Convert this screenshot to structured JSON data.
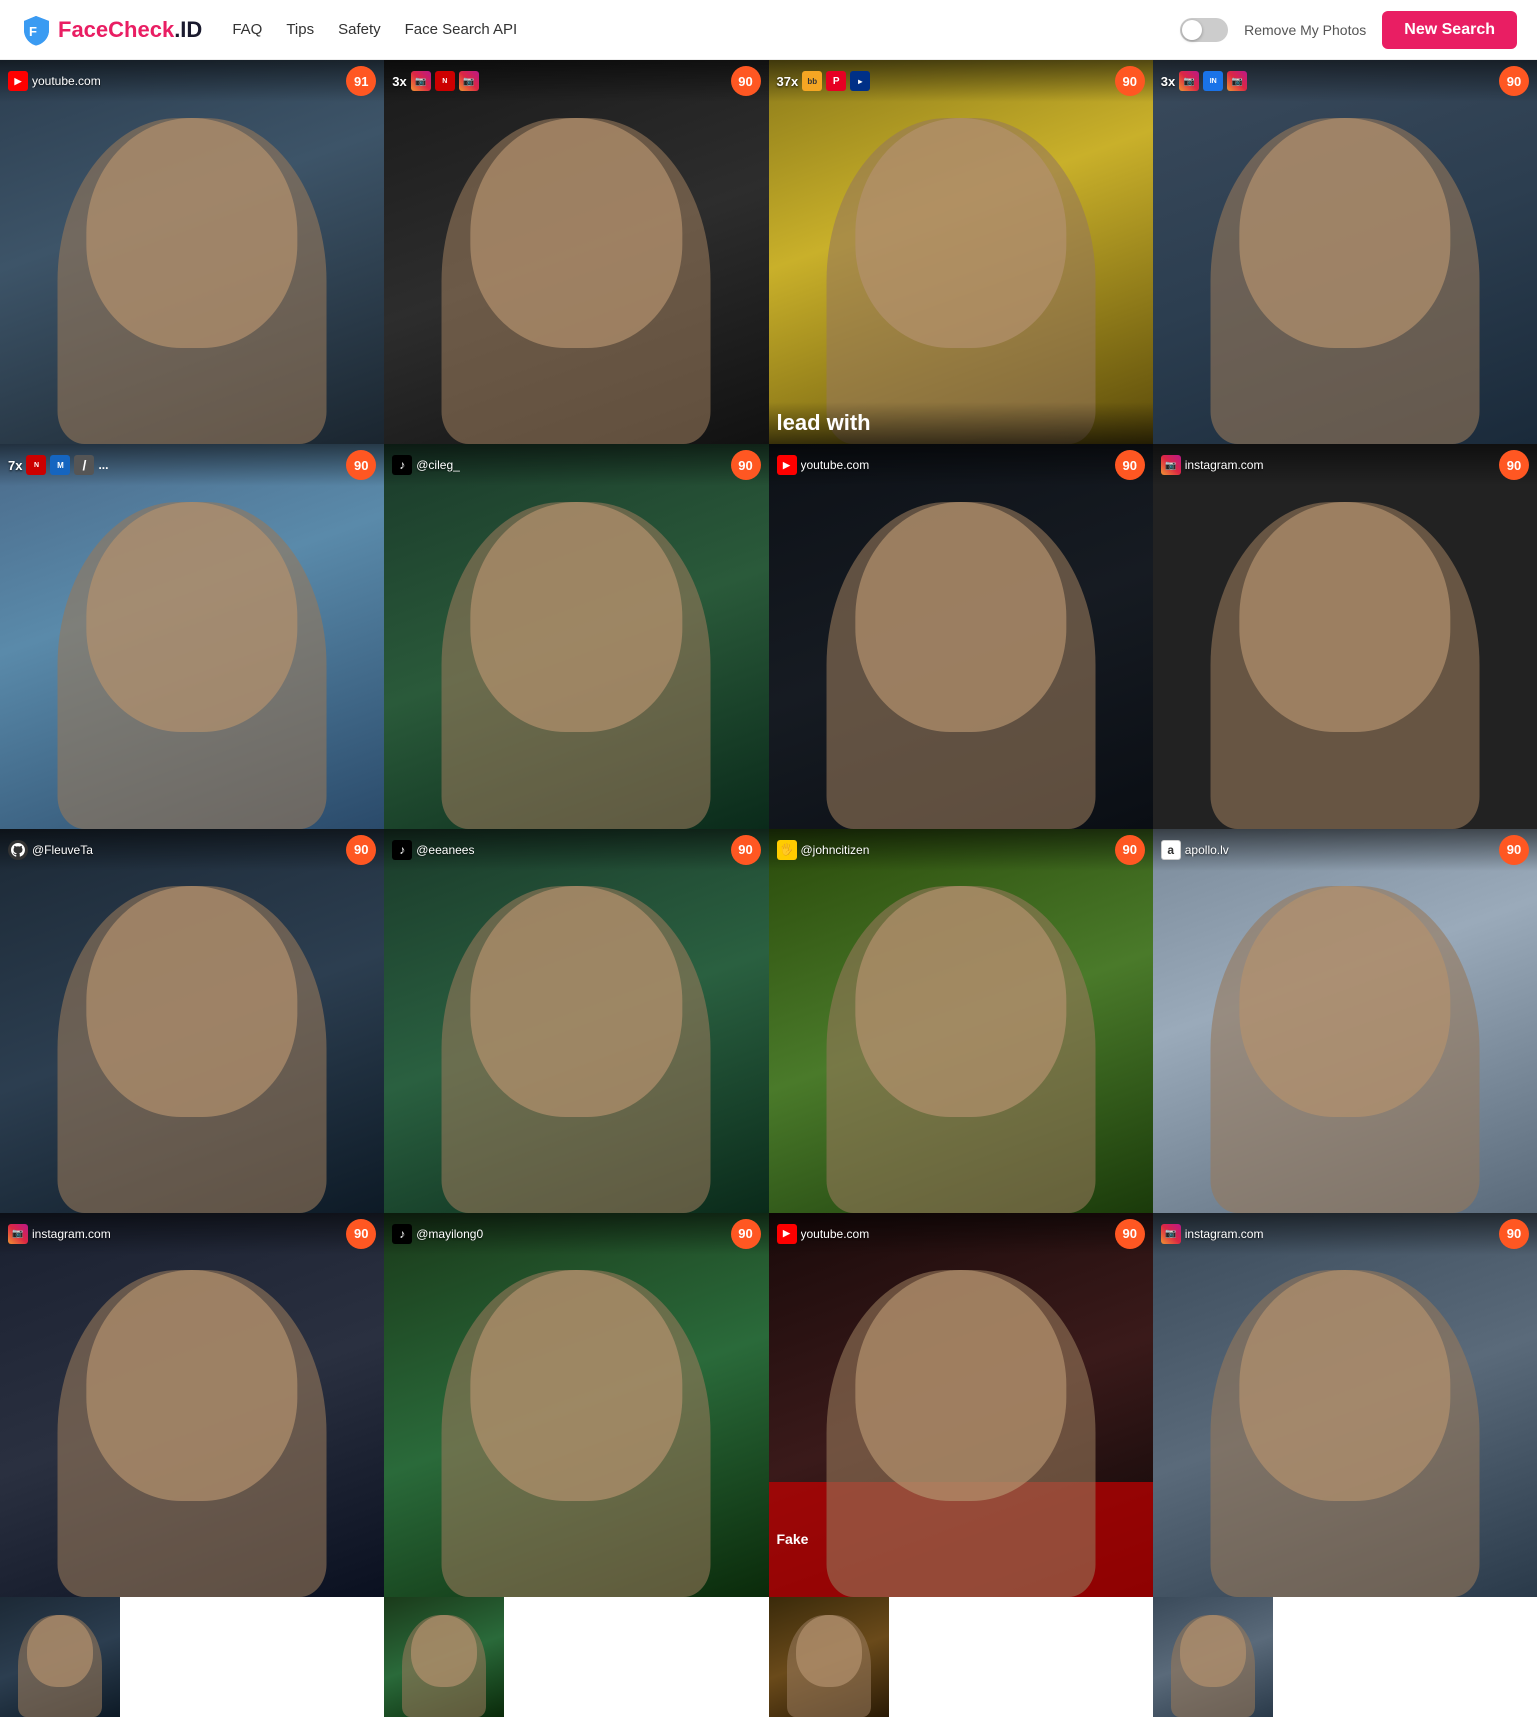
{
  "header": {
    "logo_text_brand": "FaceCheck",
    "logo_text_domain": ".ID",
    "nav": [
      {
        "label": "FAQ",
        "href": "#"
      },
      {
        "label": "Tips",
        "href": "#"
      },
      {
        "label": "Safety",
        "href": "#"
      },
      {
        "label": "Face Search API",
        "href": "#"
      }
    ],
    "remove_photos_label": "Remove My Photos",
    "new_search_label": "New Search"
  },
  "results": {
    "cells": [
      {
        "id": 1,
        "source_type": "youtube",
        "source_icon": "YT",
        "source_label": "youtube.com",
        "multiplier": null,
        "extra_icons": [],
        "score": 91,
        "bg": "face-bg-1",
        "row": 1
      },
      {
        "id": 2,
        "source_type": "instagram",
        "source_icon": "IG",
        "source_label": "",
        "multiplier": "3x",
        "extra_icons": [
          "ig",
          "nk",
          "ig"
        ],
        "score": 90,
        "bg": "face-bg-2",
        "row": 1
      },
      {
        "id": 3,
        "source_type": "instagram",
        "source_icon": "IG",
        "source_label": "",
        "multiplier": "37x",
        "extra_icons": [
          "bb",
          "pt",
          "ba"
        ],
        "score": 90,
        "bg": "face-bg-3",
        "overlay_text": "lead with",
        "row": 1
      },
      {
        "id": 4,
        "source_type": "instagram",
        "source_icon": "IG",
        "source_label": "",
        "multiplier": "3x",
        "extra_icons": [
          "ig",
          "ins",
          "ig"
        ],
        "score": 90,
        "bg": "face-bg-4",
        "row": 1
      },
      {
        "id": 5,
        "source_type": "nikkei",
        "source_icon": "NK",
        "source_label": "",
        "multiplier": "7x",
        "extra_icons": [
          "nk",
          "mc",
          "dots"
        ],
        "score": 90,
        "bg": "face-bg-5",
        "row": 2
      },
      {
        "id": 6,
        "source_type": "tiktok",
        "source_icon": "TT",
        "source_label": "@cileg_",
        "multiplier": null,
        "extra_icons": [],
        "score": 90,
        "bg": "face-bg-6",
        "row": 2
      },
      {
        "id": 7,
        "source_type": "youtube",
        "source_icon": "YT",
        "source_label": "youtube.com",
        "multiplier": null,
        "extra_icons": [],
        "score": 90,
        "bg": "face-bg-7",
        "row": 2
      },
      {
        "id": 8,
        "source_type": "instagram",
        "source_icon": "IG",
        "source_label": "instagram.com",
        "multiplier": null,
        "extra_icons": [],
        "score": 90,
        "bg": "face-bg-8",
        "row": 2
      },
      {
        "id": 9,
        "source_type": "github",
        "source_icon": "GH",
        "source_label": "@FleuveTa",
        "multiplier": null,
        "extra_icons": [],
        "score": 90,
        "bg": "face-bg-9",
        "row": 3
      },
      {
        "id": 10,
        "source_type": "tiktok",
        "source_icon": "TT",
        "source_label": "@eeanees",
        "multiplier": null,
        "extra_icons": [],
        "score": 90,
        "bg": "face-bg-10",
        "row": 3
      },
      {
        "id": 11,
        "source_type": "joinchat",
        "source_icon": "JC",
        "source_label": "@johncitizen",
        "multiplier": null,
        "extra_icons": [],
        "score": 90,
        "bg": "face-bg-11",
        "row": 3
      },
      {
        "id": 12,
        "source_type": "apollo",
        "source_icon": "a",
        "source_label": "apollo.lv",
        "multiplier": null,
        "extra_icons": [],
        "score": 90,
        "bg": "face-bg-12",
        "row": 3
      },
      {
        "id": 13,
        "source_type": "instagram",
        "source_icon": "IG",
        "source_label": "instagram.com",
        "multiplier": null,
        "extra_icons": [],
        "score": 90,
        "bg": "face-bg-1",
        "row": 4
      },
      {
        "id": 14,
        "source_type": "tiktok",
        "source_icon": "TT",
        "source_label": "@mayilong0",
        "multiplier": null,
        "extra_icons": [],
        "score": 90,
        "bg": "face-bg-2",
        "row": 4
      },
      {
        "id": 15,
        "source_type": "youtube",
        "source_icon": "YT",
        "source_label": "youtube.com",
        "multiplier": null,
        "extra_icons": [],
        "score": 90,
        "bg": "face-bg-3",
        "row": 4
      },
      {
        "id": 16,
        "source_type": "instagram",
        "source_icon": "IG",
        "source_label": "instagram.com",
        "multiplier": null,
        "extra_icons": [],
        "score": 90,
        "bg": "face-bg-4",
        "row": 4
      },
      {
        "id": 17,
        "source_type": "partial",
        "source_icon": "",
        "source_label": "",
        "multiplier": null,
        "extra_icons": [],
        "score": null,
        "bg": "face-bg-9",
        "row": 5,
        "partial": true
      },
      {
        "id": 18,
        "source_type": "partial",
        "source_icon": "",
        "source_label": "",
        "multiplier": null,
        "extra_icons": [],
        "score": null,
        "bg": "face-bg-10",
        "row": 5,
        "partial": true
      },
      {
        "id": 19,
        "source_type": "partial",
        "source_icon": "",
        "source_label": "",
        "multiplier": null,
        "extra_icons": [],
        "score": null,
        "bg": "face-bg-11",
        "row": 5,
        "partial": true
      },
      {
        "id": 20,
        "source_type": "partial",
        "source_icon": "",
        "source_label": "",
        "multiplier": null,
        "extra_icons": [],
        "score": null,
        "bg": "face-bg-12",
        "row": 5,
        "partial": true
      }
    ]
  }
}
